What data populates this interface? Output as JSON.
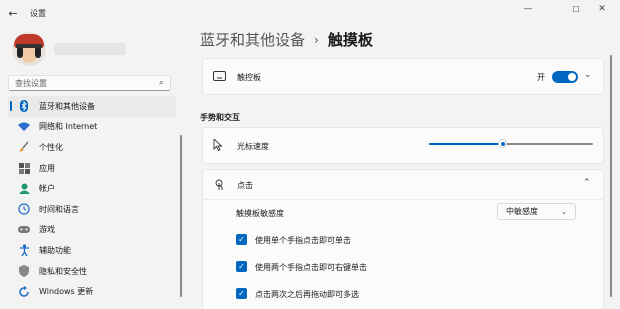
{
  "window": {
    "title": "设置",
    "back_icon": "arrow-left-icon",
    "controls": [
      "minimize-icon",
      "maximize-icon",
      "close-icon"
    ]
  },
  "sidebar": {
    "search_placeholder": "查找设置",
    "items": [
      {
        "label": "蓝牙和其他设备",
        "icon": "bluetooth-icon",
        "active": true
      },
      {
        "label": "网络和 Internet",
        "icon": "wifi-icon"
      },
      {
        "label": "个性化",
        "icon": "brush-icon"
      },
      {
        "label": "应用",
        "icon": "apps-icon"
      },
      {
        "label": "帐户",
        "icon": "person-icon"
      },
      {
        "label": "时间和语言",
        "icon": "globe-clock-icon"
      },
      {
        "label": "游戏",
        "icon": "gamepad-icon"
      },
      {
        "label": "辅助功能",
        "icon": "accessibility-icon"
      },
      {
        "label": "隐私和安全性",
        "icon": "shield-icon"
      },
      {
        "label": "Windows 更新",
        "icon": "windows-update-icon"
      }
    ]
  },
  "header": {
    "breadcrumb_parent": "蓝牙和其他设备",
    "separator": "›",
    "current": "触摸板"
  },
  "touchpad": {
    "label": "触控板",
    "icon": "touchpad-icon",
    "toggle_state": "开",
    "toggle_on": true
  },
  "gestures": {
    "heading": "手势和交互",
    "cursor_speed_label": "光标速度",
    "cursor_speed_icon": "cursor-icon",
    "cursor_speed_value": 0.45
  },
  "taps": {
    "label": "点击",
    "icon": "tap-icon",
    "expanded": true,
    "sensitivity_label": "触摸板敏感度",
    "sensitivity_value": "中敏感度",
    "options": [
      {
        "label": "使用单个手指点击即可单击",
        "checked": true
      },
      {
        "label": "使用两个手指点击即可右键单击",
        "checked": true
      },
      {
        "label": "点击两次之后再拖动即可多选",
        "checked": true
      }
    ]
  },
  "colors": {
    "accent": "#0067c0",
    "background": "#f3f3f3",
    "card": "#fbfbfb"
  }
}
